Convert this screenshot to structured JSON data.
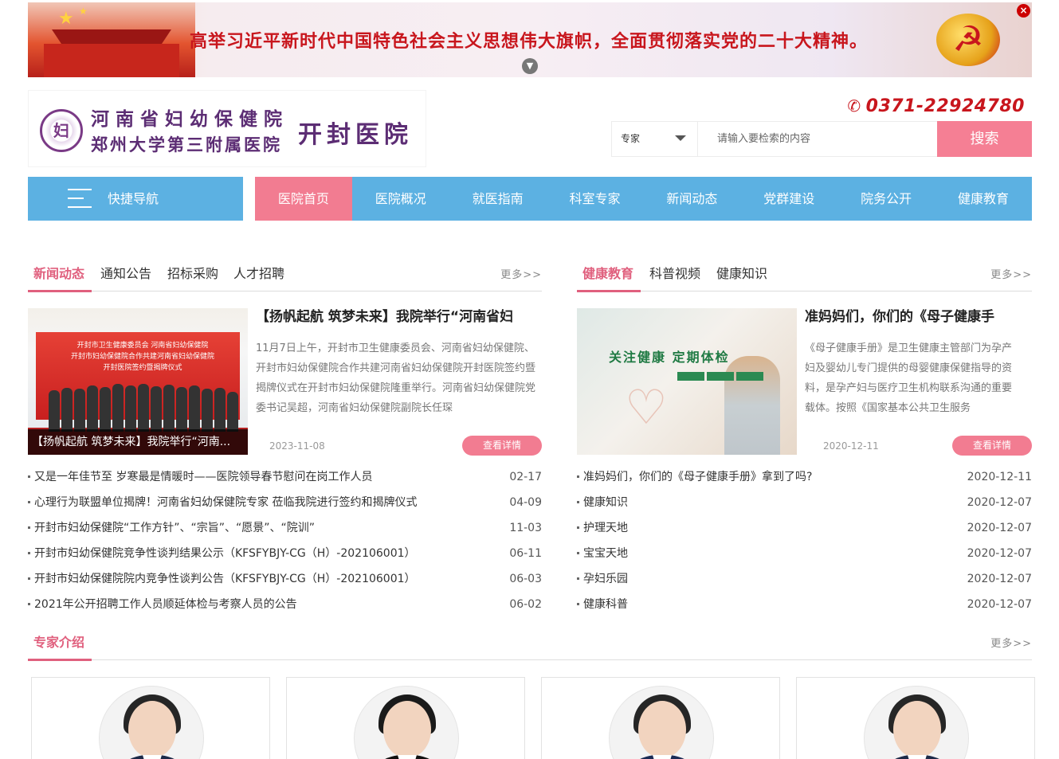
{
  "banner": {
    "slogan": "高举习近平新时代中国特色社会主义思想伟大旗帜，全面贯彻落实党的二十大精神。",
    "close_icon": "close-icon",
    "collapse_icon": "chevron-down-icon"
  },
  "header": {
    "logo_line1": "河南省妇幼保健院",
    "logo_line2": "郑州大学第三附属医院",
    "logo_right": "开封医院",
    "phone": "0371-22924780",
    "search": {
      "category": "专家",
      "placeholder": "请输入要检索的内容",
      "button": "搜索"
    }
  },
  "nav": {
    "quick": "快捷导航",
    "items": [
      "医院首页",
      "医院概况",
      "就医指南",
      "科室专家",
      "新闻动态",
      "党群建设",
      "院务公开",
      "健康教育"
    ]
  },
  "news": {
    "tabs": [
      "新闻动态",
      "通知公告",
      "招标采购",
      "人才招聘"
    ],
    "more": "更多>>",
    "featured": {
      "title": "【扬帆起航 筑梦未来】我院举行“河南省妇",
      "summary": "11月7日上午，开封市卫生健康委员会、河南省妇幼保健院、开封市妇幼保健院合作共建河南省妇幼保健院开封医院签约暨揭牌仪式在开封市妇幼保健院隆重举行。河南省妇幼保健院党委书记吴超，河南省妇幼保健院副院长任琛",
      "caption": "【扬帆起航 筑梦未来】我院举行“河南...",
      "date": "2023-11-08",
      "detail": "查看详情"
    },
    "list": [
      {
        "title": "又是一年佳节至 岁寒最是情暖时——医院领导春节慰问在岗工作人员",
        "date": "02-17"
      },
      {
        "title": "心理行为联盟单位揭牌！河南省妇幼保健院专家 莅临我院进行签约和揭牌仪式",
        "date": "04-09"
      },
      {
        "title": "开封市妇幼保健院“工作方针”、“宗旨”、“愿景”、“院训”",
        "date": "11-03"
      },
      {
        "title": "开封市妇幼保健院竞争性谈判结果公示（KFSFYBJY-CG（H）-202106001）",
        "date": "06-11"
      },
      {
        "title": "开封市妇幼保健院院内竞争性谈判公告（KFSFYBJY-CG（H）-202106001）",
        "date": "06-03"
      },
      {
        "title": "2021年公开招聘工作人员顺延体检与考察人员的公告",
        "date": "06-02"
      }
    ]
  },
  "health": {
    "tabs": [
      "健康教育",
      "科普视频",
      "健康知识"
    ],
    "more": "更多>>",
    "featured": {
      "title": "准妈妈们，你们的《母子健康手",
      "summary": "《母子健康手册》是卫生健康主管部门为孕产妇及婴幼儿专门提供的母婴健康保健指导的资料，是孕产妇与医疗卫生机构联系沟通的重要载体。按照《国家基本公共卫生服务",
      "image_text": "关注健康  定期体检",
      "date": "2020-12-11",
      "detail": "查看详情"
    },
    "list": [
      {
        "title": "准妈妈们，你们的《母子健康手册》拿到了吗?",
        "date": "2020-12-11"
      },
      {
        "title": "健康知识",
        "date": "2020-12-07"
      },
      {
        "title": "护理天地",
        "date": "2020-12-07"
      },
      {
        "title": "宝宝天地",
        "date": "2020-12-07"
      },
      {
        "title": "孕妇乐园",
        "date": "2020-12-07"
      },
      {
        "title": "健康科普",
        "date": "2020-12-07"
      }
    ]
  },
  "experts": {
    "title": "专家介绍",
    "more": "更多>>"
  },
  "colors": {
    "accent_pink": "#f27c91",
    "nav_blue": "#5cb1e2",
    "logo_purple": "#5c2d74",
    "phone_red": "#c8161d"
  }
}
